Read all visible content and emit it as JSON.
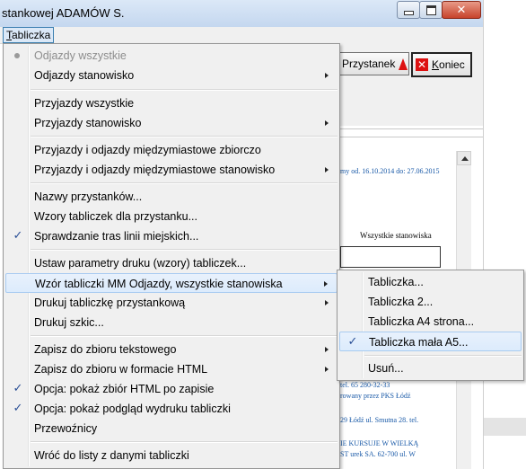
{
  "window": {
    "title": "stankowej ADAMÓW S."
  },
  "menubar": {
    "active_prefix": "T",
    "active_rest": "abliczka"
  },
  "toolbar": {
    "przystanek_label": "Przystanek",
    "koniec_prefix": "K",
    "koniec_rest": "oniec"
  },
  "document": {
    "validity_text": "my od. 16.10.2014 do: 27.06.2015",
    "all_stations_label": "Wszystkie stanowiska",
    "lines": [
      "tel. 65 280-32-33",
      "rowany przez PKS Łódź",
      "29 Łódź ul. Smutna 28. tel.",
      "IE KURSUJE W WIELKĄ",
      "ST urek SA. 62-700 ul. W"
    ]
  },
  "menu": {
    "items": [
      {
        "label": "Odjazdy wszystkie",
        "state": "bullet",
        "disabled": true
      },
      {
        "label": "Odjazdy stanowisko",
        "submenu": true
      },
      {
        "label": "Przyjazdy wszystkie"
      },
      {
        "label": "Przyjazdy stanowisko",
        "submenu": true
      },
      {
        "label": "Przyjazdy i odjazdy międzymiastowe zbiorczo"
      },
      {
        "label": "Przyjazdy i odjazdy międzymiastowe stanowisko",
        "submenu": true
      },
      {
        "label": "Nazwy przystanków..."
      },
      {
        "label": "Wzory tabliczek dla przystanku..."
      },
      {
        "label": "Sprawdzanie tras linii miejskich...",
        "checked": true
      },
      {
        "label": "Ustaw parametry druku (wzory) tabliczek..."
      },
      {
        "label": "Wzór tabliczki MM Odjazdy, wszystkie stanowiska",
        "submenu": true,
        "highlighted": true
      },
      {
        "label": "Drukuj tabliczkę przystankową",
        "submenu": true
      },
      {
        "label": "Drukuj szkic..."
      },
      {
        "label": "Zapisz do zbioru tekstowego",
        "submenu": true
      },
      {
        "label": "Zapisz do zbioru w formacie HTML",
        "submenu": true
      },
      {
        "label": "Opcja: pokaż zbiór HTML po zapisie",
        "checked": true
      },
      {
        "label": "Opcja: pokaż podgląd wydruku tabliczki",
        "checked": true
      },
      {
        "label": "Przewoźnicy"
      },
      {
        "label": "Wróć do listy z danymi tabliczki"
      }
    ],
    "check_glyph": "✓"
  },
  "submenu": {
    "items": [
      {
        "label": "Tabliczka..."
      },
      {
        "label": "Tabliczka 2..."
      },
      {
        "label": "Tabliczka A4 strona..."
      },
      {
        "label": "Tabliczka mała A5...",
        "checked": true,
        "highlighted": true
      },
      {
        "label": "Usuń..."
      }
    ]
  }
}
